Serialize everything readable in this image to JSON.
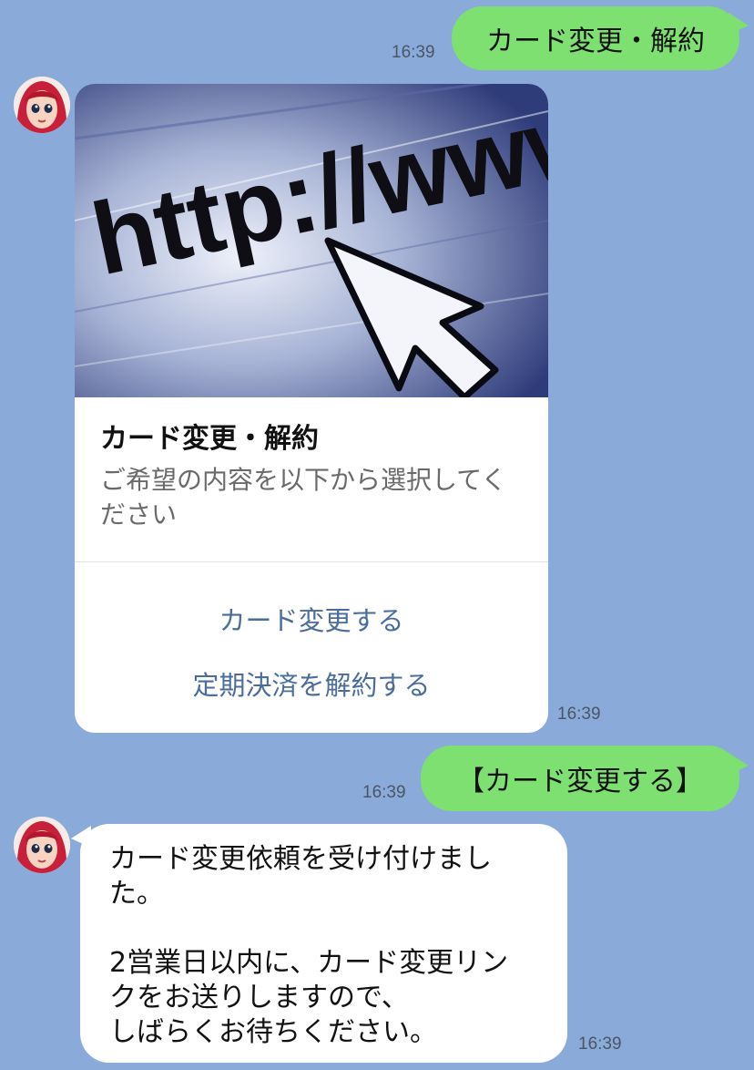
{
  "messages": {
    "out1": {
      "text": "カード変更・解約",
      "time": "16:39"
    },
    "card": {
      "image_text": "http://www",
      "title": "カード変更・解約",
      "desc_line1": "ご希望の内容を以下から選択してく",
      "desc_line2": "ださい",
      "action1": "カード変更する",
      "action2": "定期決済を解約する",
      "time": "16:39"
    },
    "out2": {
      "text": "【カード変更する】",
      "time": "16:39"
    },
    "in2": {
      "line1": "カード変更依頼を受け付けまし",
      "line2": "た。",
      "line3": "2営業日以内に、カード変更リン",
      "line4": "クをお送りしますので、",
      "line5": "しばらくお待ちください。",
      "time": "16:39"
    }
  },
  "colors": {
    "background": "#8aabd9",
    "outgoing_bubble": "#7ee071",
    "incoming_bubble": "#ffffff",
    "action_link": "#4a6d9d"
  },
  "icons": {
    "avatar": "avatar-anime-girl"
  }
}
